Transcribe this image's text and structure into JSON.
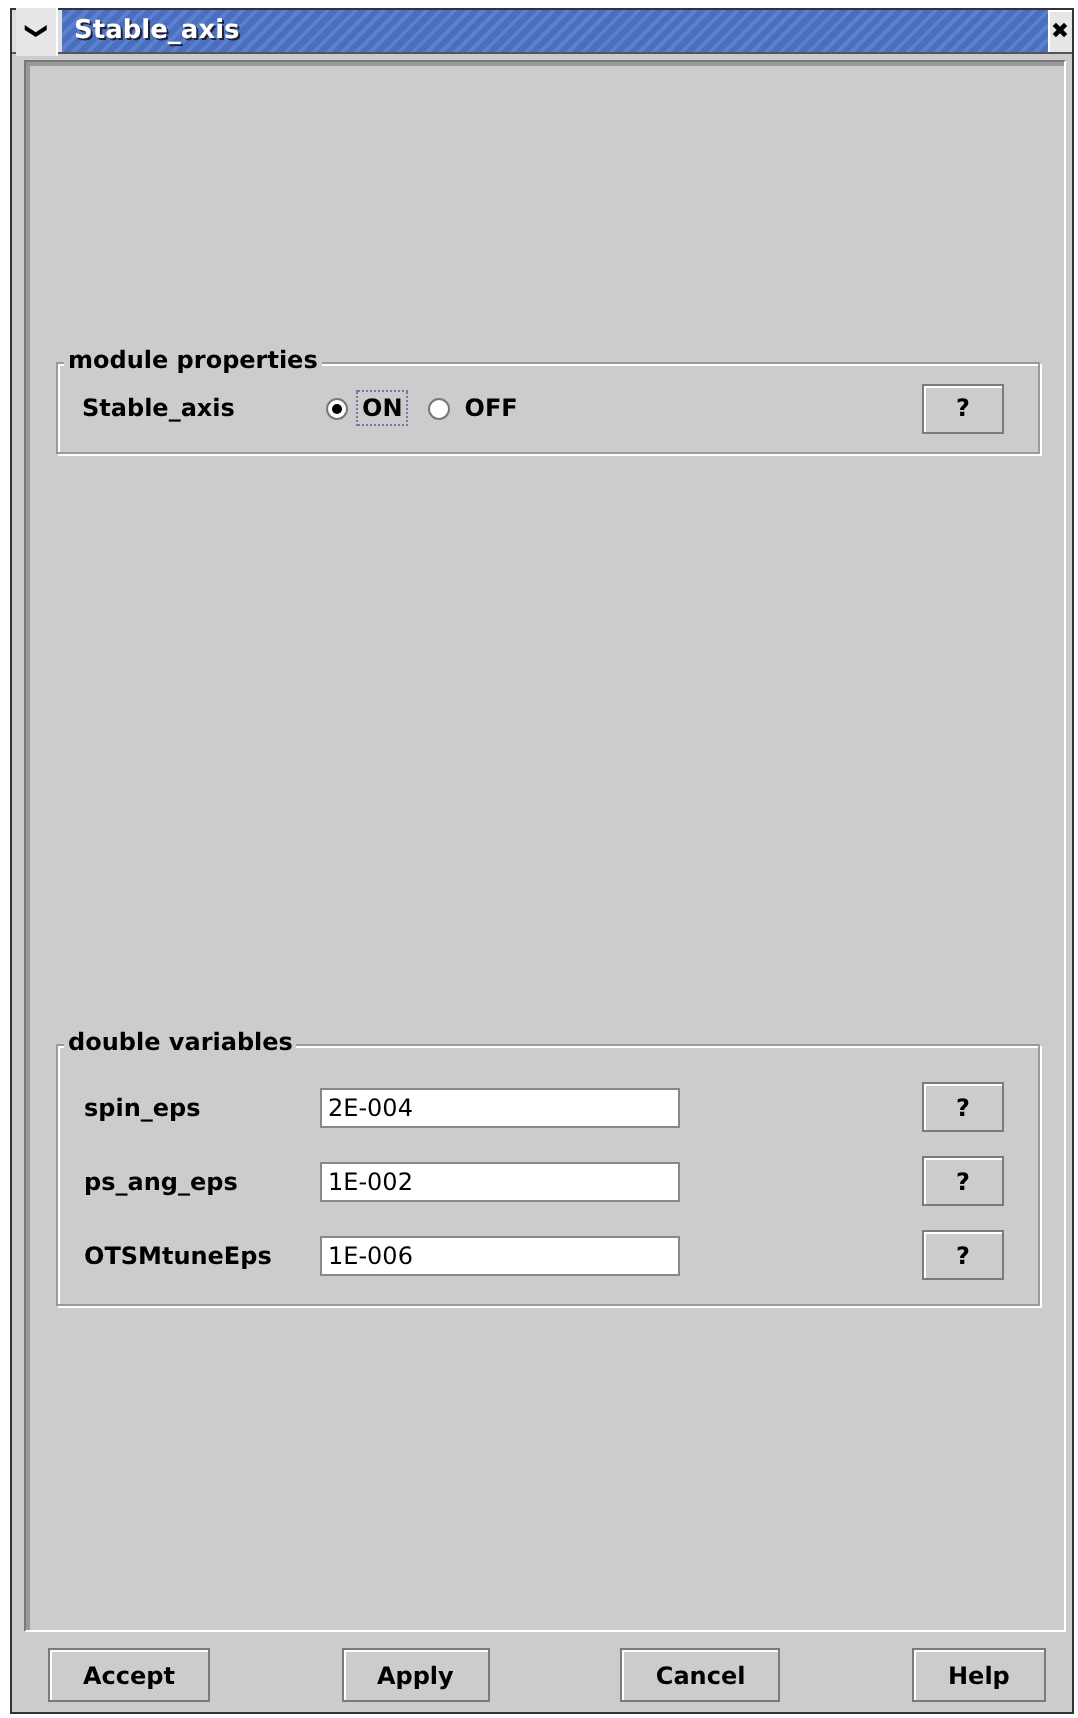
{
  "window": {
    "title": "Stable_axis",
    "menu_icon": "❯",
    "close_icon": "✖"
  },
  "module_properties": {
    "title": "module properties",
    "rows": [
      {
        "label": "Stable_axis",
        "options": [
          {
            "label": "ON",
            "selected": true,
            "focused": true
          },
          {
            "label": "OFF",
            "selected": false,
            "focused": false
          }
        ],
        "help": "?"
      }
    ]
  },
  "double_variables": {
    "title": "double variables",
    "rows": [
      {
        "label": "spin_eps",
        "value": "2E-004",
        "help": "?"
      },
      {
        "label": "ps_ang_eps",
        "value": "1E-002",
        "help": "?"
      },
      {
        "label": "OTSMtuneEps",
        "value": "1E-006",
        "help": "?"
      }
    ]
  },
  "buttons": [
    "Accept",
    "Apply",
    "Cancel",
    "Help"
  ]
}
